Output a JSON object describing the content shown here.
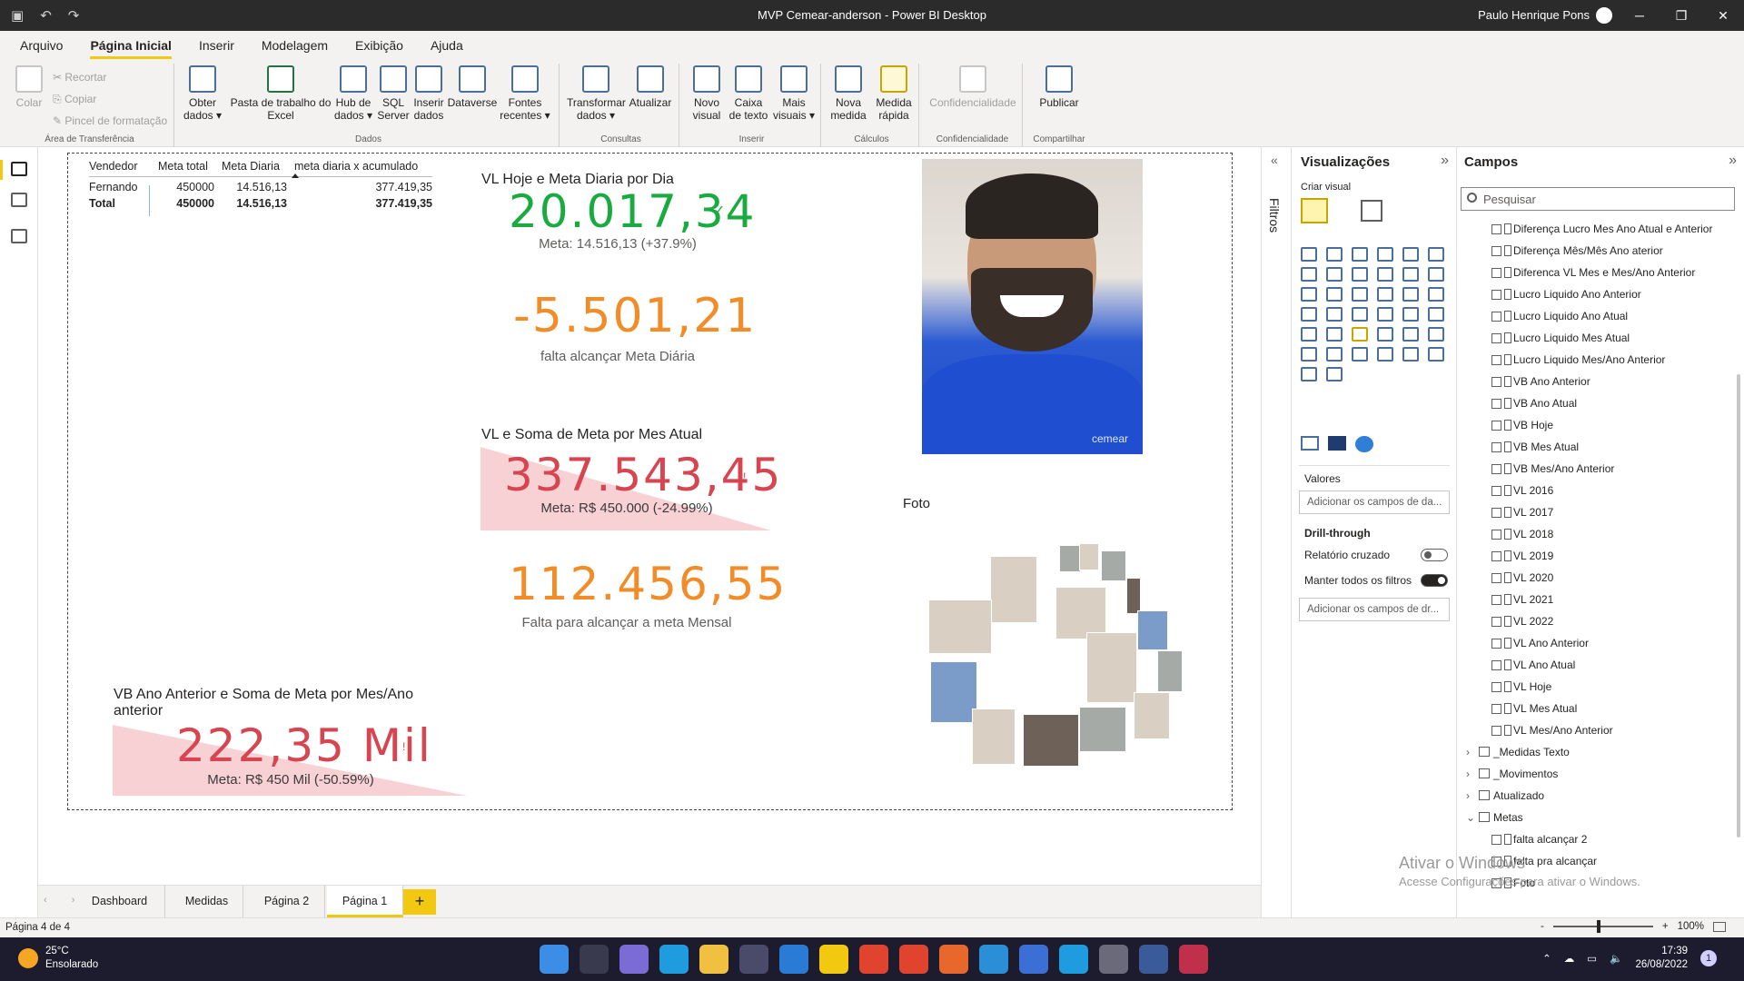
{
  "titlebar": {
    "title": "MVP Cemear-anderson - Power BI Desktop",
    "user": "Paulo Henrique Pons",
    "minimize": "─",
    "restore": "❐",
    "close": "✕"
  },
  "menu": {
    "items": [
      "Arquivo",
      "Página Inicial",
      "Inserir",
      "Modelagem",
      "Exibição",
      "Ajuda"
    ]
  },
  "ribbon": {
    "clipboard": {
      "paste": "Colar",
      "cut": "Recortar",
      "copy": "Copiar",
      "format_painter": "Pincel de formatação",
      "label": "Área de Transferência"
    },
    "data": {
      "label": "Dados",
      "get_data": "Obter dados",
      "excel": "Pasta de trabalho do Excel",
      "hub": "Hub de dados",
      "sql": "SQL Server",
      "enter_data": "Inserir dados",
      "dataverse": "Dataverse",
      "recent": "Fontes recentes"
    },
    "queries": {
      "label": "Consultas",
      "transform": "Transformar dados",
      "refresh": "Atualizar"
    },
    "insert": {
      "label": "Inserir",
      "new_visual": "Novo visual",
      "text_box": "Caixa de texto",
      "more_visuals": "Mais visuais"
    },
    "calculations": {
      "label": "Cálculos",
      "new_measure": "Nova medida",
      "quick_measure": "Medida rápida"
    },
    "sensitivity": {
      "label": "Confidencialidade",
      "button": "Confidencialidade"
    },
    "share": {
      "label": "Compartilhar",
      "publish": "Publicar"
    }
  },
  "table_visual": {
    "headers": [
      "Vendedor",
      "Meta total",
      "Meta Diaria",
      "meta diaria x acumulado"
    ],
    "rows": [
      {
        "vendedor": "Fernando",
        "meta_total": "450000",
        "meta_diaria": "14.516,13",
        "acumulado": "377.419,35"
      }
    ],
    "total": {
      "vendedor": "Total",
      "meta_total": "450000",
      "meta_diaria": "14.516,13",
      "acumulado": "377.419,35"
    }
  },
  "kpi1": {
    "title": "VL Hoje e Meta Diaria por Dia",
    "value": "20.017,34",
    "check": "✓",
    "goal": "Meta: 14.516,13 (+37.9%)"
  },
  "card1": {
    "value": "-5.501,21",
    "label": "falta alcançar Meta Diária"
  },
  "kpi2": {
    "title": "VL e Soma de Meta por Mes Atual",
    "value": "337.543,45",
    "mark": "!",
    "goal": "Meta: R$ 450.000 (-24.99%)"
  },
  "card2": {
    "value": "112.456,55",
    "label": "Falta para alcançar a meta Mensal"
  },
  "kpi3": {
    "title": "VB Ano Anterior e Soma de Meta por Mes/Ano anterior",
    "value": "222,35 Mil",
    "mark": "!",
    "goal": "Meta: R$ 450 Mil (-50.59%)"
  },
  "photo": {
    "brand": "cemear",
    "label": "Foto"
  },
  "filters": {
    "label": "Filtros"
  },
  "visualizations": {
    "title": "Visualizações",
    "build": "Criar visual",
    "values_label": "Valores",
    "values_placeholder": "Adicionar os campos de da...",
    "drillthrough_label": "Drill-through",
    "cross_report": "Relatório cruzado",
    "keep_filters": "Manter todos os filtros",
    "drill_placeholder": "Adicionar os campos de dr..."
  },
  "fields": {
    "title": "Campos",
    "search_placeholder": "Pesquisar",
    "measures": [
      "Diferença Lucro Mes Ano Atual e Anterior",
      "Diferença Mês/Mês Ano aterior",
      "Diferenca VL Mes e Mes/Ano Anterior",
      "Lucro Liquido Ano Anterior",
      "Lucro Liquido Ano Atual",
      "Lucro Liquido Mes Atual",
      "Lucro Liquido Mes/Ano Anterior",
      "VB Ano Anterior",
      "VB Ano Atual",
      "VB Hoje",
      "VB Mes Atual",
      "VB Mes/Ano Anterior",
      "VL 2016",
      "VL 2017",
      "VL 2018",
      "VL 2019",
      "VL 2020",
      "VL 2021",
      "VL 2022",
      "VL Ano Anterior",
      "VL Ano Atual",
      "VL Hoje",
      "VL Mes Atual",
      "VL Mes/Ano Anterior"
    ],
    "tables": [
      "_Medidas Texto",
      "_Movimentos",
      "Atualizado",
      "Metas"
    ],
    "metas_items": [
      "falta alcançar 2",
      "falta pra alcançar",
      "Foto"
    ]
  },
  "watermark": {
    "line1": "Ativar o Windows",
    "line2": "Acesse Configurações para ativar o Windows."
  },
  "tabs": {
    "items": [
      "Dashboard",
      "Medidas",
      "Página 2",
      "Página 1"
    ],
    "active": "Página 1",
    "add": "+"
  },
  "status": {
    "page": "Página 4 de 4",
    "zoom": "100%",
    "minus": "-",
    "plus": "+"
  },
  "taskbar": {
    "temp": "25°C",
    "weather": "Ensolarado",
    "time": "17:39",
    "date": "26/08/2022",
    "notifications": "1"
  }
}
